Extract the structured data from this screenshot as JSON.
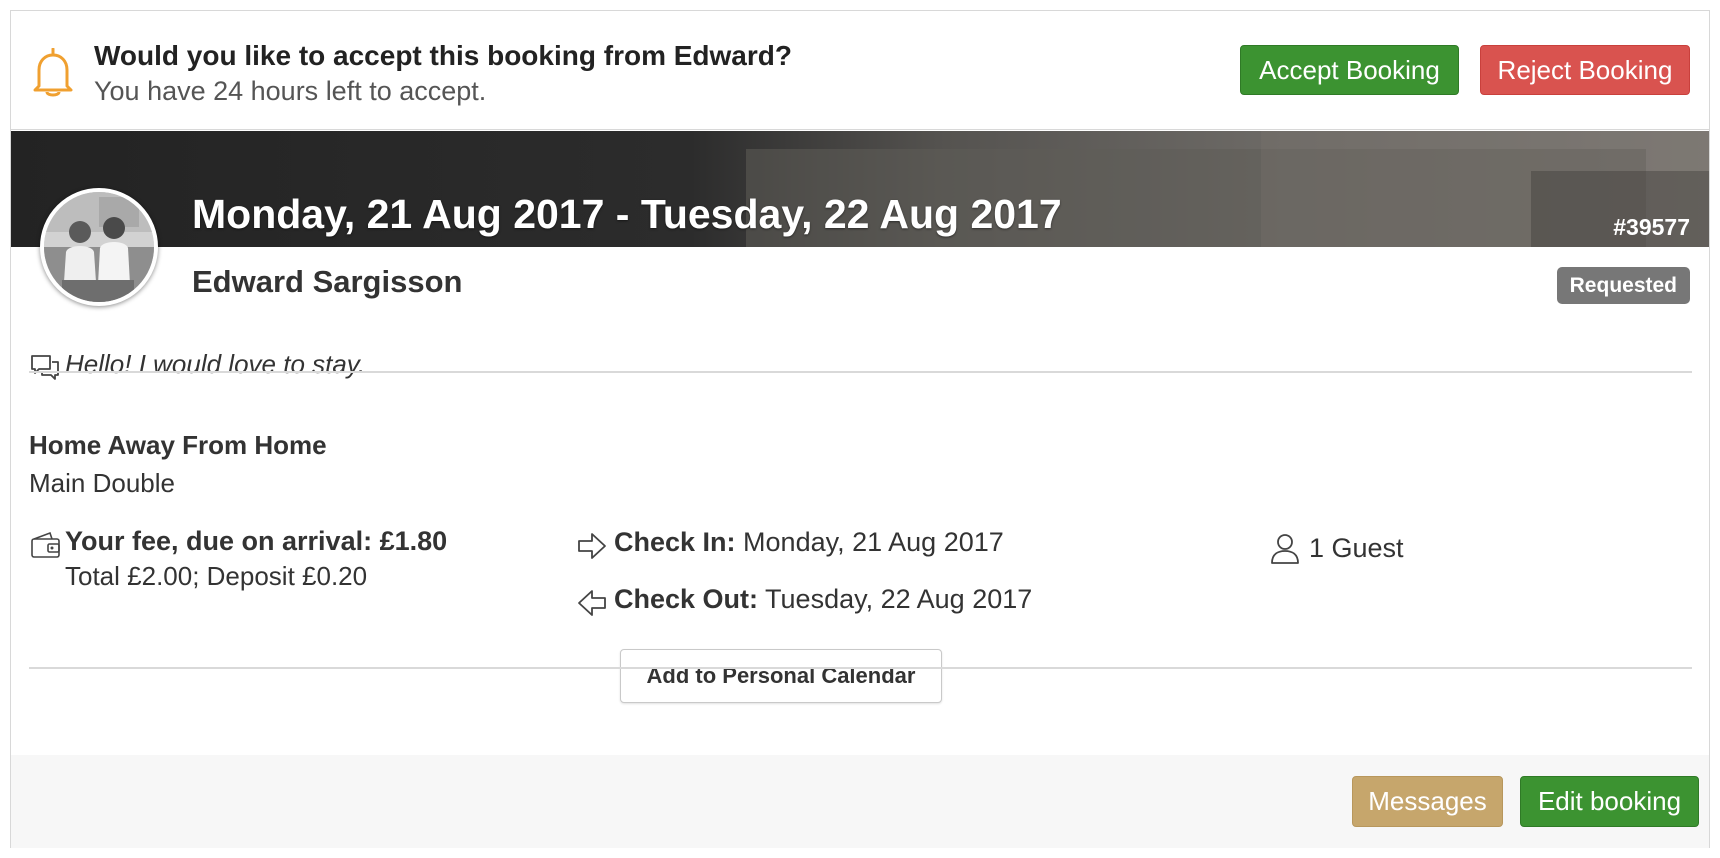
{
  "alert": {
    "title": "Would you like to accept this booking from Edward?",
    "subtitle": "You have 24 hours left to accept.",
    "accept_label": "Accept Booking",
    "reject_label": "Reject Booking",
    "icon": "bell-icon"
  },
  "booking": {
    "dates": "Monday, 21 Aug 2017 - Tuesday, 22 Aug 2017",
    "reference": "#39577",
    "guest_name": "Edward Sargisson",
    "status": "Requested",
    "message": "Hello! I would love to stay.",
    "property": "Home Away From Home",
    "room": "Main Double",
    "fee": "Your fee, due on arrival: £1.80",
    "fee_detail": "Total £2.00; Deposit £0.20",
    "check_in_label": "Check In:",
    "check_in_value": "Monday, 21 Aug 2017",
    "check_out_label": "Check Out:",
    "check_out_value": "Tuesday, 22 Aug 2017",
    "calendar_label": "Add to Personal Calendar",
    "guests": "1 Guest"
  },
  "footer": {
    "messages_label": "Messages",
    "edit_label": "Edit booking"
  },
  "colors": {
    "accept": "#3c9331",
    "reject": "#d9534f",
    "messages": "#c6a66c",
    "badge": "#777777",
    "bell": "#f0a030"
  }
}
